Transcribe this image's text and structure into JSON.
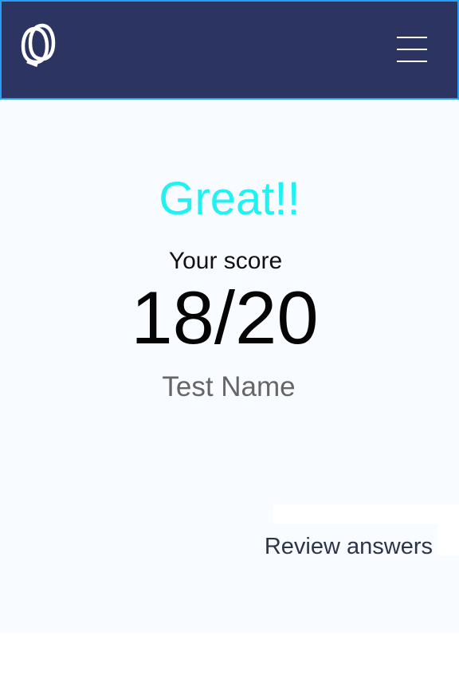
{
  "header": {
    "logo_icon": "double-q-logo-icon",
    "menu_icon": "hamburger-menu-icon",
    "background_color": "#2c3461",
    "border_color": "#2a9df4"
  },
  "result": {
    "headline": "Great!!",
    "headline_color": "#1ff2f2",
    "score_label": "Your score",
    "score_value": "18/20",
    "test_name": "Test Name"
  },
  "actions": {
    "review_label": "Review answers"
  }
}
